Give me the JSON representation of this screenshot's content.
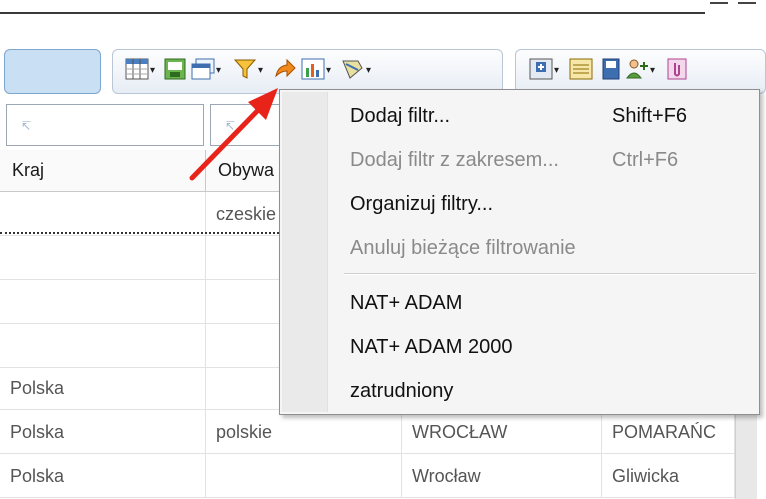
{
  "toolbar": {
    "icons_left": [
      "columns-icon",
      "export-icon",
      "window-icon",
      "filter-icon",
      "share-arrow-icon",
      "chart-icon",
      "brush-icon"
    ],
    "icons_right": [
      "add-icon",
      "list-icon",
      "save-icon",
      "user-add-icon",
      "attach-icon"
    ]
  },
  "grid": {
    "filter_placeholder_icon": "↸",
    "columns": [
      "Kraj",
      "Obywa"
    ],
    "rows": [
      [
        "",
        "czeskie",
        "",
        ""
      ],
      [
        "",
        "",
        "",
        ""
      ],
      [
        "",
        "",
        "",
        ""
      ],
      [
        "",
        "",
        "",
        ""
      ],
      [
        "Polska",
        "",
        "",
        ""
      ],
      [
        "Polska",
        "polskie",
        "WROCŁAW",
        "POMARAŃC"
      ],
      [
        "Polska",
        "",
        "Wrocław",
        "Gliwicka"
      ]
    ]
  },
  "menu": {
    "items": [
      {
        "label": "Dodaj filtr...",
        "shortcut": "Shift+F6",
        "enabled": true
      },
      {
        "label": "Dodaj filtr z zakresem...",
        "shortcut": "Ctrl+F6",
        "enabled": false
      },
      {
        "label": "Organizuj filtry...",
        "shortcut": "",
        "enabled": true
      },
      {
        "label": "Anuluj bieżące filtrowanie",
        "shortcut": "",
        "enabled": false
      },
      {
        "label": "NAT+ ADAM",
        "shortcut": "",
        "enabled": true
      },
      {
        "label": "NAT+ ADAM 2000",
        "shortcut": "",
        "enabled": true
      },
      {
        "label": "zatrudniony",
        "shortcut": "",
        "enabled": true
      }
    ]
  },
  "colors": {
    "accent": "#c9dff4",
    "arrow": "#e8231a",
    "menu_bg": "#f5f5f5",
    "disabled_text": "#8a8a8a"
  }
}
